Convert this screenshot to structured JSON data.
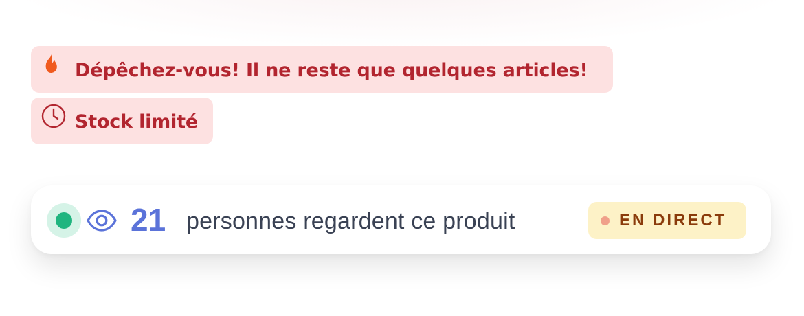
{
  "alerts": {
    "urgent": {
      "icon": "flame-icon",
      "text": "Dépêchez-vous! Il ne reste que quelques articles!"
    },
    "stock": {
      "icon": "clock-icon",
      "text": "Stock limité"
    }
  },
  "viewers": {
    "indicator": "online-dot",
    "icon": "eye-icon",
    "count": "21",
    "text": "personnes regardent ce produit",
    "badge": {
      "label": "EN DIRECT"
    }
  },
  "colors": {
    "alert_background": "#fde1e1",
    "alert_text": "#b2252f",
    "flame": "#f05a1e",
    "online_green": "#1fb57f",
    "eye_blue": "#5b73d9",
    "viewer_text": "#3a4254",
    "live_badge_background": "#fdf2c7",
    "live_badge_text": "#8a3b0b",
    "live_badge_dot": "#f0a08a"
  }
}
